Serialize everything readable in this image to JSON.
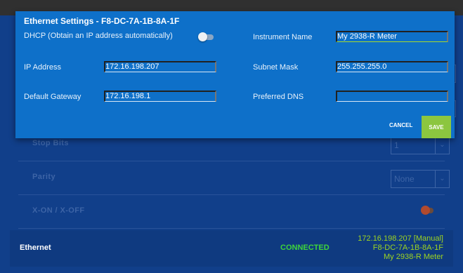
{
  "dialog": {
    "title": "Ethernet Settings - F8-DC-7A-1B-8A-1F",
    "dhcp_label": "DHCP (Obtain an IP address automatically)",
    "dhcp_enabled": false,
    "instrument_name_label": "Instrument Name",
    "instrument_name_value": "My 2938-R Meter",
    "ip_label": "IP Address",
    "ip_value": "172.16.198.207",
    "subnet_label": "Subnet Mask",
    "subnet_value": "255.255.255.0",
    "gateway_label": "Default Gateway",
    "gateway_value": "172.16.198.1",
    "dns_label": "Preferred DNS",
    "dns_value": "",
    "cancel_label": "CANCEL",
    "save_label": "SAVE"
  },
  "background": {
    "stop_bits_label": "Stop Bits",
    "stop_bits_value": "1",
    "parity_label": "Parity",
    "parity_value": "None",
    "xon_label": "X-ON / X-OFF",
    "xon_enabled": true
  },
  "status": {
    "name": "Ethernet",
    "state": "CONNECTED",
    "info_line1": "172.16.198.207 [Manual]",
    "info_line2": "F8-DC-7A-1B-8A-1F",
    "info_line3": "My 2938-R Meter"
  },
  "colors": {
    "dialog_bg": "#0e70c9",
    "app_bg": "#113f8a",
    "accent_green": "#8cc63f",
    "connected_green": "#3ed43a",
    "info_green": "#9ed421"
  },
  "icons": {
    "select_arrow": "chevron-down-icon",
    "toggle": "toggle-switch"
  }
}
